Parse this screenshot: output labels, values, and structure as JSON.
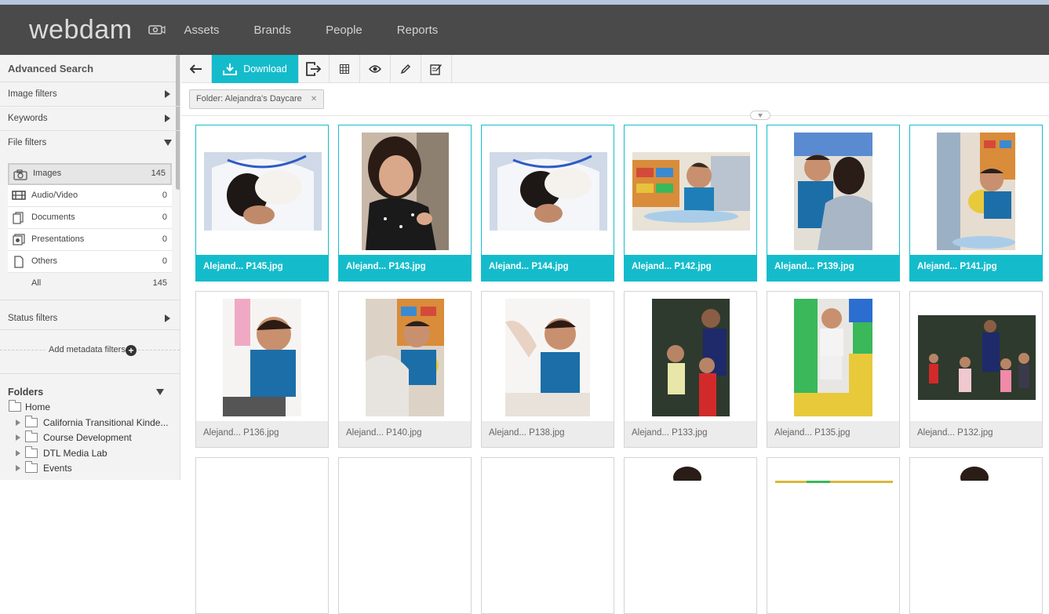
{
  "header": {
    "logo": "webdam",
    "nav": [
      "Assets",
      "Brands",
      "People",
      "Reports"
    ]
  },
  "sidebar": {
    "title": "Advanced Search",
    "filters": {
      "image": "Image filters",
      "keywords": "Keywords",
      "file": "File filters"
    },
    "file_types": [
      {
        "label": "Images",
        "count": "145",
        "icon": "camera-icon"
      },
      {
        "label": "Audio/Video",
        "count": "0",
        "icon": "film-icon"
      },
      {
        "label": "Documents",
        "count": "0",
        "icon": "documents-icon"
      },
      {
        "label": "Presentations",
        "count": "0",
        "icon": "presentation-icon"
      },
      {
        "label": "Others",
        "count": "0",
        "icon": "file-icon"
      },
      {
        "label": "All",
        "count": "145",
        "icon": ""
      }
    ],
    "status": "Status filters",
    "add_meta": "Add metadata filters",
    "folders_title": "Folders",
    "folders": [
      "Home",
      "California Transitional Kinde...",
      "Course Development",
      "DTL Media Lab",
      "Events"
    ]
  },
  "toolbar": {
    "download": "Download"
  },
  "filter_chip": "Folder: Alejandra's Daycare",
  "assets": [
    {
      "name": "Alejand... P145.jpg",
      "selected": true
    },
    {
      "name": "Alejand... P143.jpg",
      "selected": true
    },
    {
      "name": "Alejand... P144.jpg",
      "selected": true
    },
    {
      "name": "Alejand... P142.jpg",
      "selected": true
    },
    {
      "name": "Alejand... P139.jpg",
      "selected": true
    },
    {
      "name": "Alejand... P141.jpg",
      "selected": true
    },
    {
      "name": "Alejand... P136.jpg",
      "selected": false
    },
    {
      "name": "Alejand... P140.jpg",
      "selected": false
    },
    {
      "name": "Alejand... P138.jpg",
      "selected": false
    },
    {
      "name": "Alejand... P133.jpg",
      "selected": false
    },
    {
      "name": "Alejand... P135.jpg",
      "selected": false
    },
    {
      "name": "Alejand... P132.jpg",
      "selected": false
    }
  ],
  "colors": {
    "accent": "#14bccb",
    "header": "#4a4a4a"
  }
}
